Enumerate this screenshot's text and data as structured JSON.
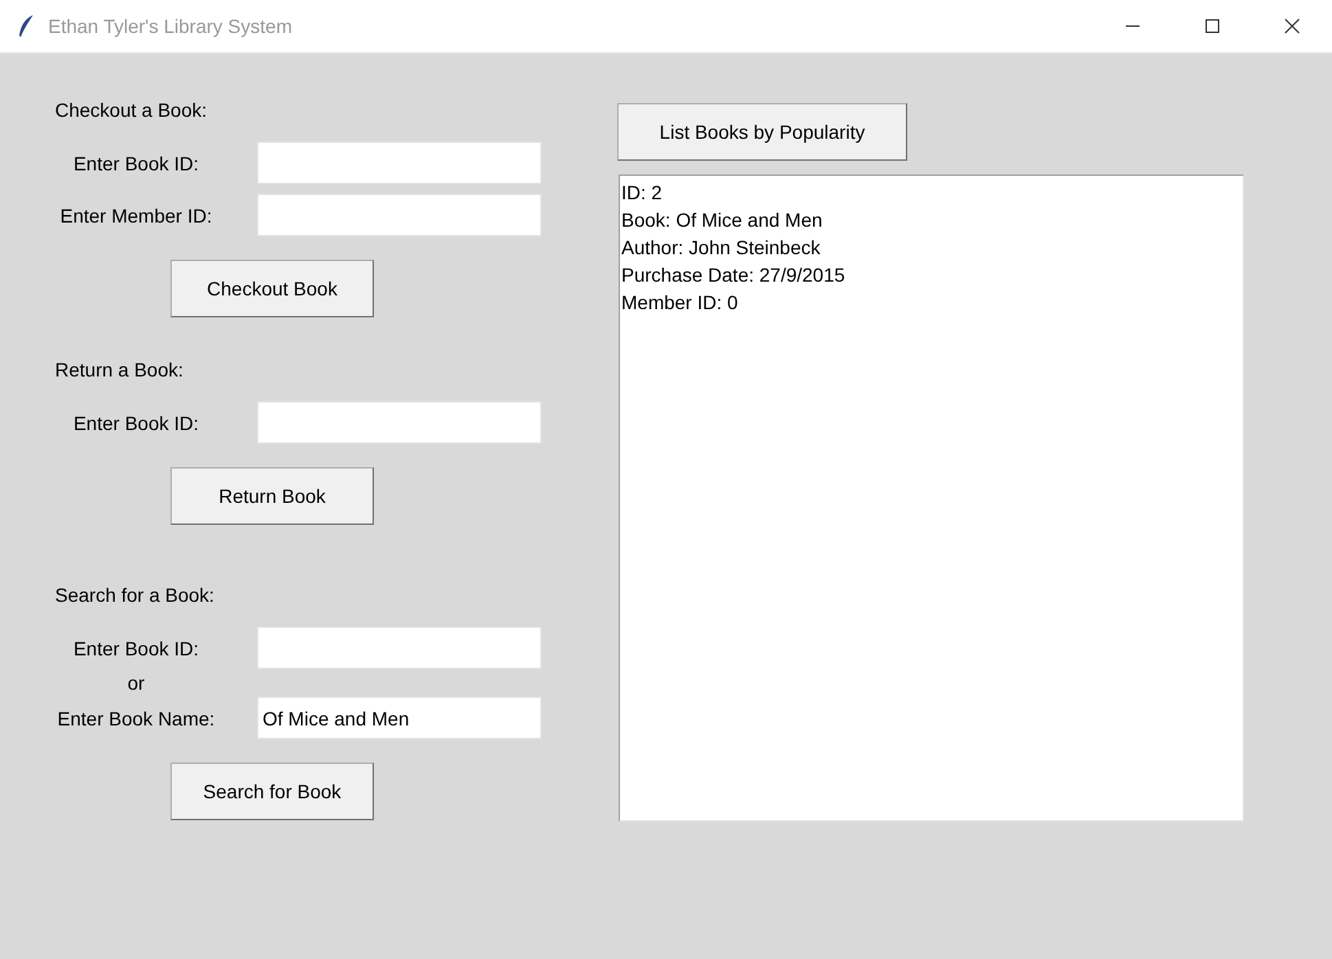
{
  "window": {
    "title": "Ethan Tyler's Library System"
  },
  "sections": [
    {
      "title": "Checkout a Book:",
      "rows": [
        {
          "kind": "field",
          "label": "Enter Book ID:"
        },
        {
          "kind": "field",
          "label": "Enter Member ID:"
        }
      ],
      "button": "Checkout Book"
    },
    {
      "title": "Return a Book:",
      "rows": [
        {
          "kind": "field",
          "label": "Enter Book ID:"
        }
      ],
      "button": "Return Book"
    },
    {
      "title": "Search for a Book:",
      "rows": [
        {
          "kind": "field",
          "label": "Enter Book ID:"
        },
        {
          "kind": "separator",
          "label": "or"
        },
        {
          "kind": "field",
          "label": "Enter Book Name:",
          "value": "Of Mice and Men"
        }
      ],
      "button": "Search for Book"
    }
  ],
  "list_button": "List Books by Popularity",
  "results": [
    "ID: 2",
    "Book: Of Mice and Men",
    "Author: John Steinbeck",
    "Purchase Date: 27/9/2015",
    "Member ID: 0"
  ]
}
